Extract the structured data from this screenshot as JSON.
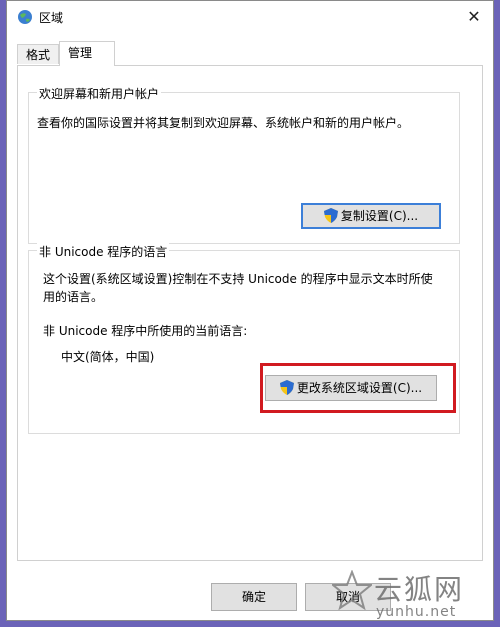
{
  "window": {
    "title": "区域"
  },
  "tabs": [
    {
      "label": "格式",
      "active": false
    },
    {
      "label": "管理",
      "active": true
    }
  ],
  "welcome_group": {
    "title": "欢迎屏幕和新用户帐户",
    "description": "查看你的国际设置并将其复制到欢迎屏幕、系统帐户和新的用户帐户。",
    "copy_button": "复制设置(C)..."
  },
  "unicode_group": {
    "title": "非 Unicode 程序的语言",
    "description_line1": "这个设置(系统区域设置)控制在不支持 Unicode 的程序中显示文本时所使",
    "description_line2": "用的语言。",
    "current_label": "非 Unicode 程序中所使用的当前语言:",
    "current_value": "中文(简体，中国)",
    "change_button": "更改系统区域设置(C)..."
  },
  "footer": {
    "ok": "确定",
    "cancel": "取消"
  },
  "watermark": {
    "main": "云狐网",
    "sub": "yunhu.net"
  },
  "colors": {
    "highlight": "#d11a20",
    "focus": "#3c7fd8",
    "background": "#6b63b8"
  }
}
